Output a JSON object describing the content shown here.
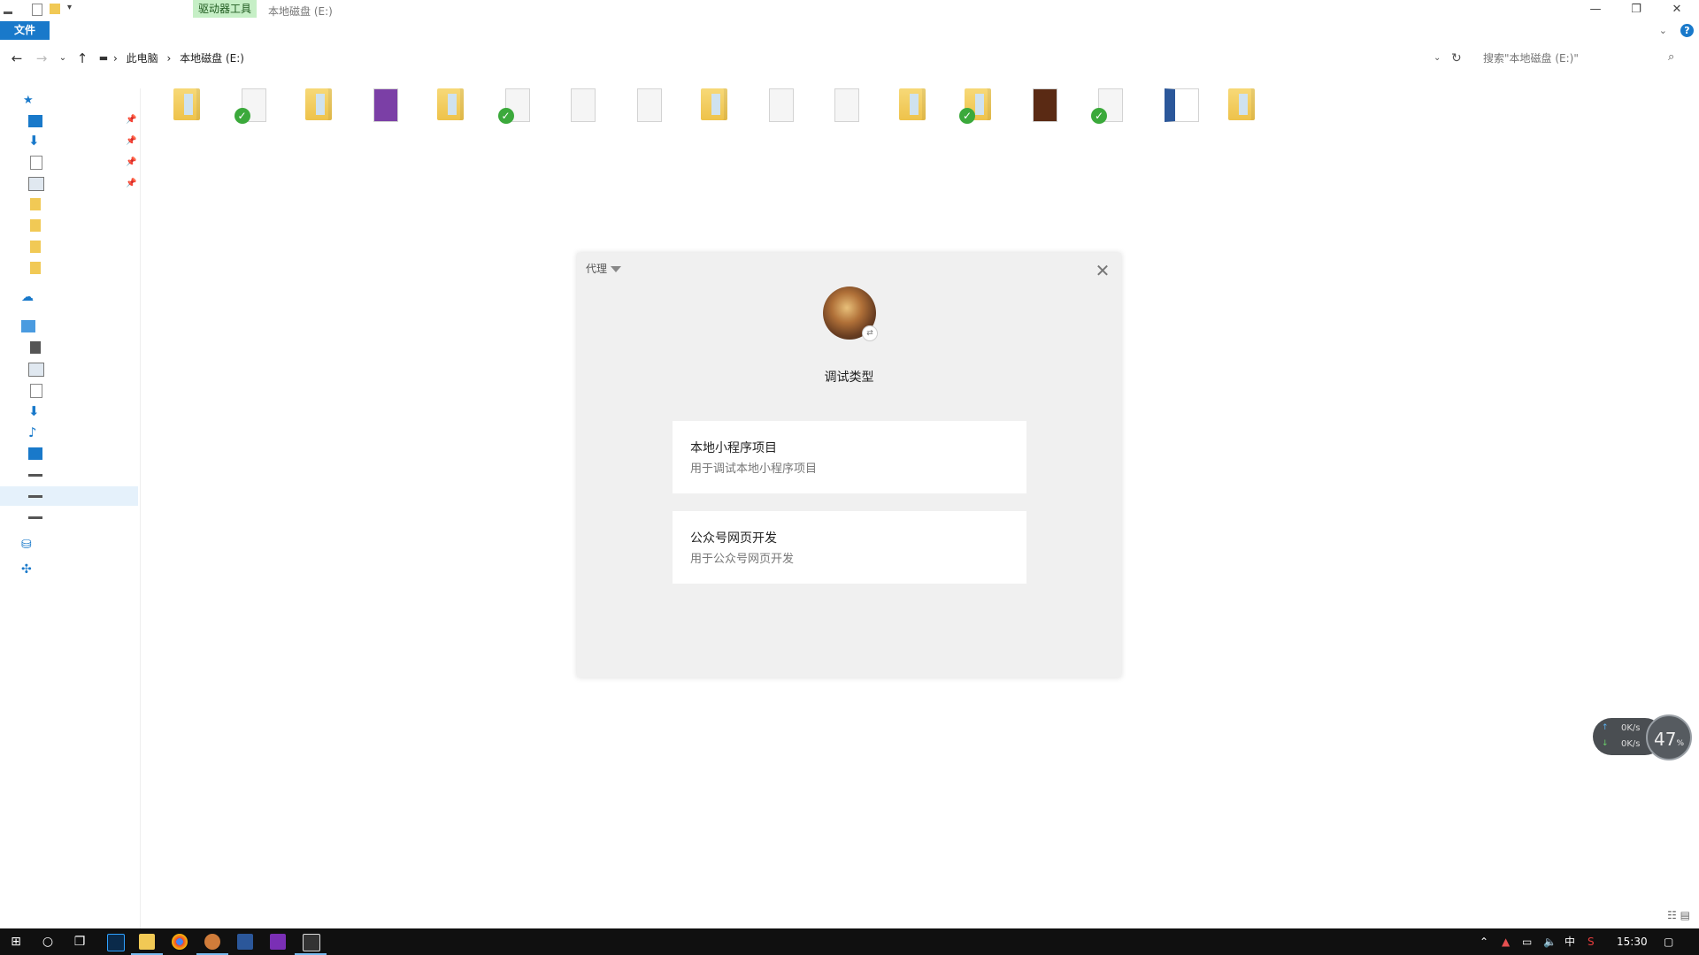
{
  "titlebar": {
    "active_tool_tab": "驱动器工具",
    "window_title": "本地磁盘 (E:)",
    "file_tab": "文件",
    "minimize": "—",
    "restore": "❐",
    "close": "✕",
    "help": "?"
  },
  "addressbar": {
    "breadcrumb": [
      "此电脑",
      "本地磁盘 (E:)"
    ],
    "separator": "›",
    "search_placeholder": "搜索\"本地磁盘 (E:)\""
  },
  "files": [
    {
      "type": "folder",
      "synced": false
    },
    {
      "type": "doc",
      "synced": true
    },
    {
      "type": "folder",
      "synced": false
    },
    {
      "type": "onenote",
      "synced": false
    },
    {
      "type": "folder",
      "synced": false
    },
    {
      "type": "doc",
      "synced": true
    },
    {
      "type": "doc",
      "synced": false
    },
    {
      "type": "doc",
      "synced": false
    },
    {
      "type": "folder",
      "synced": false
    },
    {
      "type": "doc",
      "synced": false
    },
    {
      "type": "doc",
      "synced": false
    },
    {
      "type": "folder",
      "synced": false
    },
    {
      "type": "folder",
      "synced": true
    },
    {
      "type": "book",
      "synced": false
    },
    {
      "type": "doc",
      "synced": true
    },
    {
      "type": "word",
      "synced": false
    },
    {
      "type": "folder",
      "synced": false
    }
  ],
  "dialog": {
    "proxy_label": "代理",
    "title": "调试类型",
    "options": [
      {
        "title": "本地小程序项目",
        "desc": "用于调试本地小程序项目"
      },
      {
        "title": "公众号网页开发",
        "desc": "用于公众号网页开发"
      }
    ]
  },
  "net_widget": {
    "up_speed": "0K/s",
    "down_speed": "0K/s",
    "percent": "47",
    "percent_sign": "%"
  },
  "taskbar": {
    "clock": "15:30",
    "ime": "中",
    "apps": [
      "start-icon",
      "search-icon",
      "task-view-icon",
      "photoshop-icon",
      "file-explorer-icon",
      "chrome-icon",
      "app-orange-icon",
      "word-icon",
      "axure-icon",
      "window-icon"
    ]
  },
  "colors": {
    "accent": "#1979ca",
    "drive_tools_tab": "#c6efc6",
    "dialog_bg": "#f0f0f0",
    "taskbar": "#101010"
  }
}
